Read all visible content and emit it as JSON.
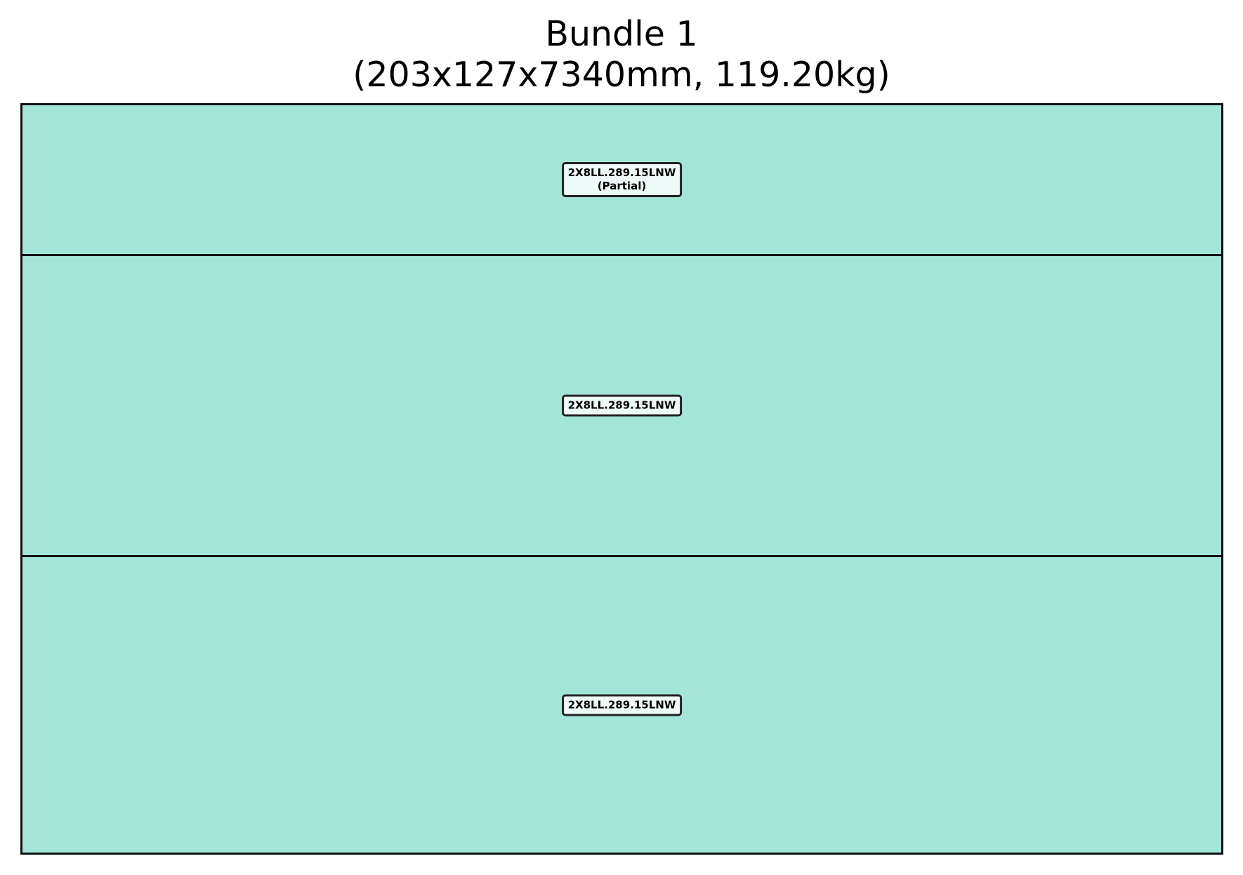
{
  "title": {
    "line1": "Bundle 1",
    "line2": "(203x127x7340mm, 119.20kg)"
  },
  "colors": {
    "layer_fill": "#a3e6d8",
    "label_fill": "#eefaf7",
    "border": "#111111"
  },
  "layers": [
    {
      "part": "2X8LL.289.15LNW",
      "note": "(Partial)"
    },
    {
      "part": "2X8LL.289.15LNW",
      "note": ""
    },
    {
      "part": "2X8LL.289.15LNW",
      "note": ""
    }
  ]
}
